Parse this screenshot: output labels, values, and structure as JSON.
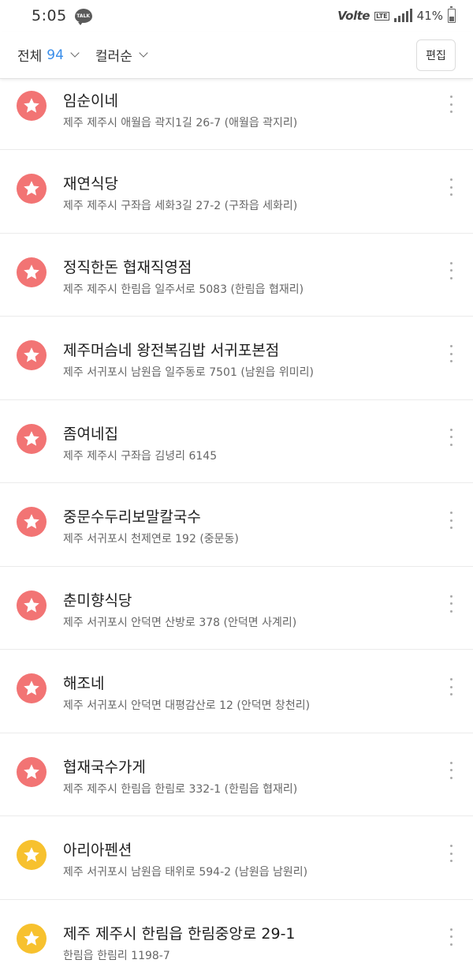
{
  "status_bar": {
    "time": "5:05",
    "talk_label": "TALK",
    "volte": "Volte",
    "lte": "LTE",
    "battery": "41%"
  },
  "toolbar": {
    "filter_label": "전체",
    "filter_count": "94",
    "sort_label": "컬러순",
    "edit_label": "편집"
  },
  "colors": {
    "red": "#f27474",
    "yellow": "#f7c12e",
    "accent": "#3a8eea"
  },
  "items": [
    {
      "title": "임순이네",
      "address": "제주 제주시 애월읍 곽지1길 26-7 (애월읍 곽지리)",
      "color": "#f27474"
    },
    {
      "title": "재연식당",
      "address": "제주 제주시 구좌읍 세화3길 27-2 (구좌읍 세화리)",
      "color": "#f27474"
    },
    {
      "title": "정직한돈 협재직영점",
      "address": "제주 제주시 한림읍 일주서로 5083 (한림읍 협재리)",
      "color": "#f27474"
    },
    {
      "title": "제주머슴네 왕전복김밥 서귀포본점",
      "address": "제주 서귀포시 남원읍 일주동로 7501 (남원읍 위미리)",
      "color": "#f27474"
    },
    {
      "title": "좀여네집",
      "address": "제주 제주시 구좌읍 김녕리 6145",
      "color": "#f27474"
    },
    {
      "title": "중문수두리보말칼국수",
      "address": "제주 서귀포시 천제연로 192 (중문동)",
      "color": "#f27474"
    },
    {
      "title": "춘미향식당",
      "address": "제주 서귀포시 안덕면 산방로 378 (안덕면 사계리)",
      "color": "#f27474"
    },
    {
      "title": "해조네",
      "address": "제주 서귀포시 안덕면 대평감산로 12 (안덕면 창천리)",
      "color": "#f27474"
    },
    {
      "title": "협재국수가게",
      "address": "제주 제주시 한림읍 한림로 332-1 (한림읍 협재리)",
      "color": "#f27474"
    },
    {
      "title": "아리아펜션",
      "address": "제주 서귀포시 남원읍 태위로 594-2 (남원읍 남원리)",
      "color": "#f7c12e"
    },
    {
      "title": "제주 제주시 한림읍 한림중앙로 29-1",
      "address": "한림읍 한림리 1198-7",
      "color": "#f7c12e"
    }
  ]
}
